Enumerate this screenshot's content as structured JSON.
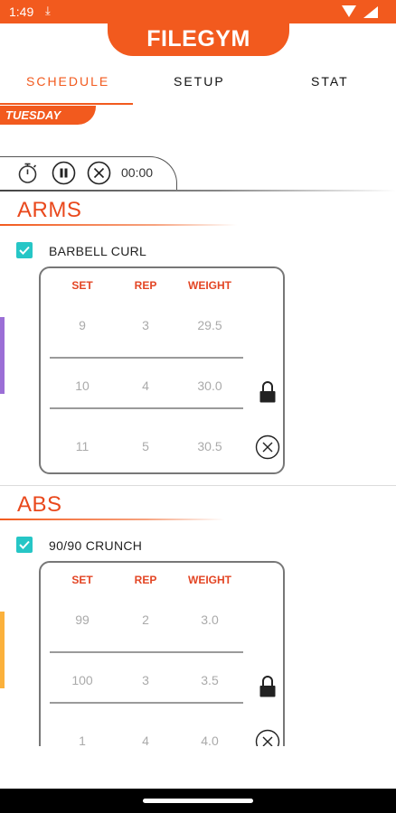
{
  "status_bar": {
    "time": "1:49",
    "download_icon": "download-arrow-icon",
    "wifi_icon": "wifi-icon",
    "battery_icon": "battery-icon"
  },
  "app": {
    "title": "FILEGYM",
    "accent": "#f25a1e"
  },
  "tabs": [
    {
      "label": "SCHEDULE",
      "active": true
    },
    {
      "label": "SETUP",
      "active": false
    },
    {
      "label": "STAT",
      "active": false
    }
  ],
  "day": "TUESDAY",
  "timer": {
    "time": "00:00",
    "icons": [
      "stopwatch-icon",
      "pause-icon",
      "stop-icon"
    ]
  },
  "columns": {
    "set": "SET",
    "rep": "REP",
    "weight": "WEIGHT"
  },
  "sections": [
    {
      "title": "ARMS",
      "accent": "#9b6fd6",
      "exercise": {
        "name": "BARBELL CURL",
        "checked": true,
        "locked": true,
        "rows": [
          {
            "set": "9",
            "rep": "3",
            "weight": "29.5"
          },
          {
            "set": "10",
            "rep": "4",
            "weight": "30.0"
          },
          {
            "set": "11",
            "rep": "5",
            "weight": "30.5"
          }
        ]
      }
    },
    {
      "title": "ABS",
      "accent": "#fbb13c",
      "exercise": {
        "name": "90/90 CRUNCH",
        "checked": true,
        "locked": true,
        "rows": [
          {
            "set": "99",
            "rep": "2",
            "weight": "3.0"
          },
          {
            "set": "100",
            "rep": "3",
            "weight": "3.5"
          },
          {
            "set": "1",
            "rep": "4",
            "weight": "4.0"
          }
        ]
      }
    }
  ]
}
